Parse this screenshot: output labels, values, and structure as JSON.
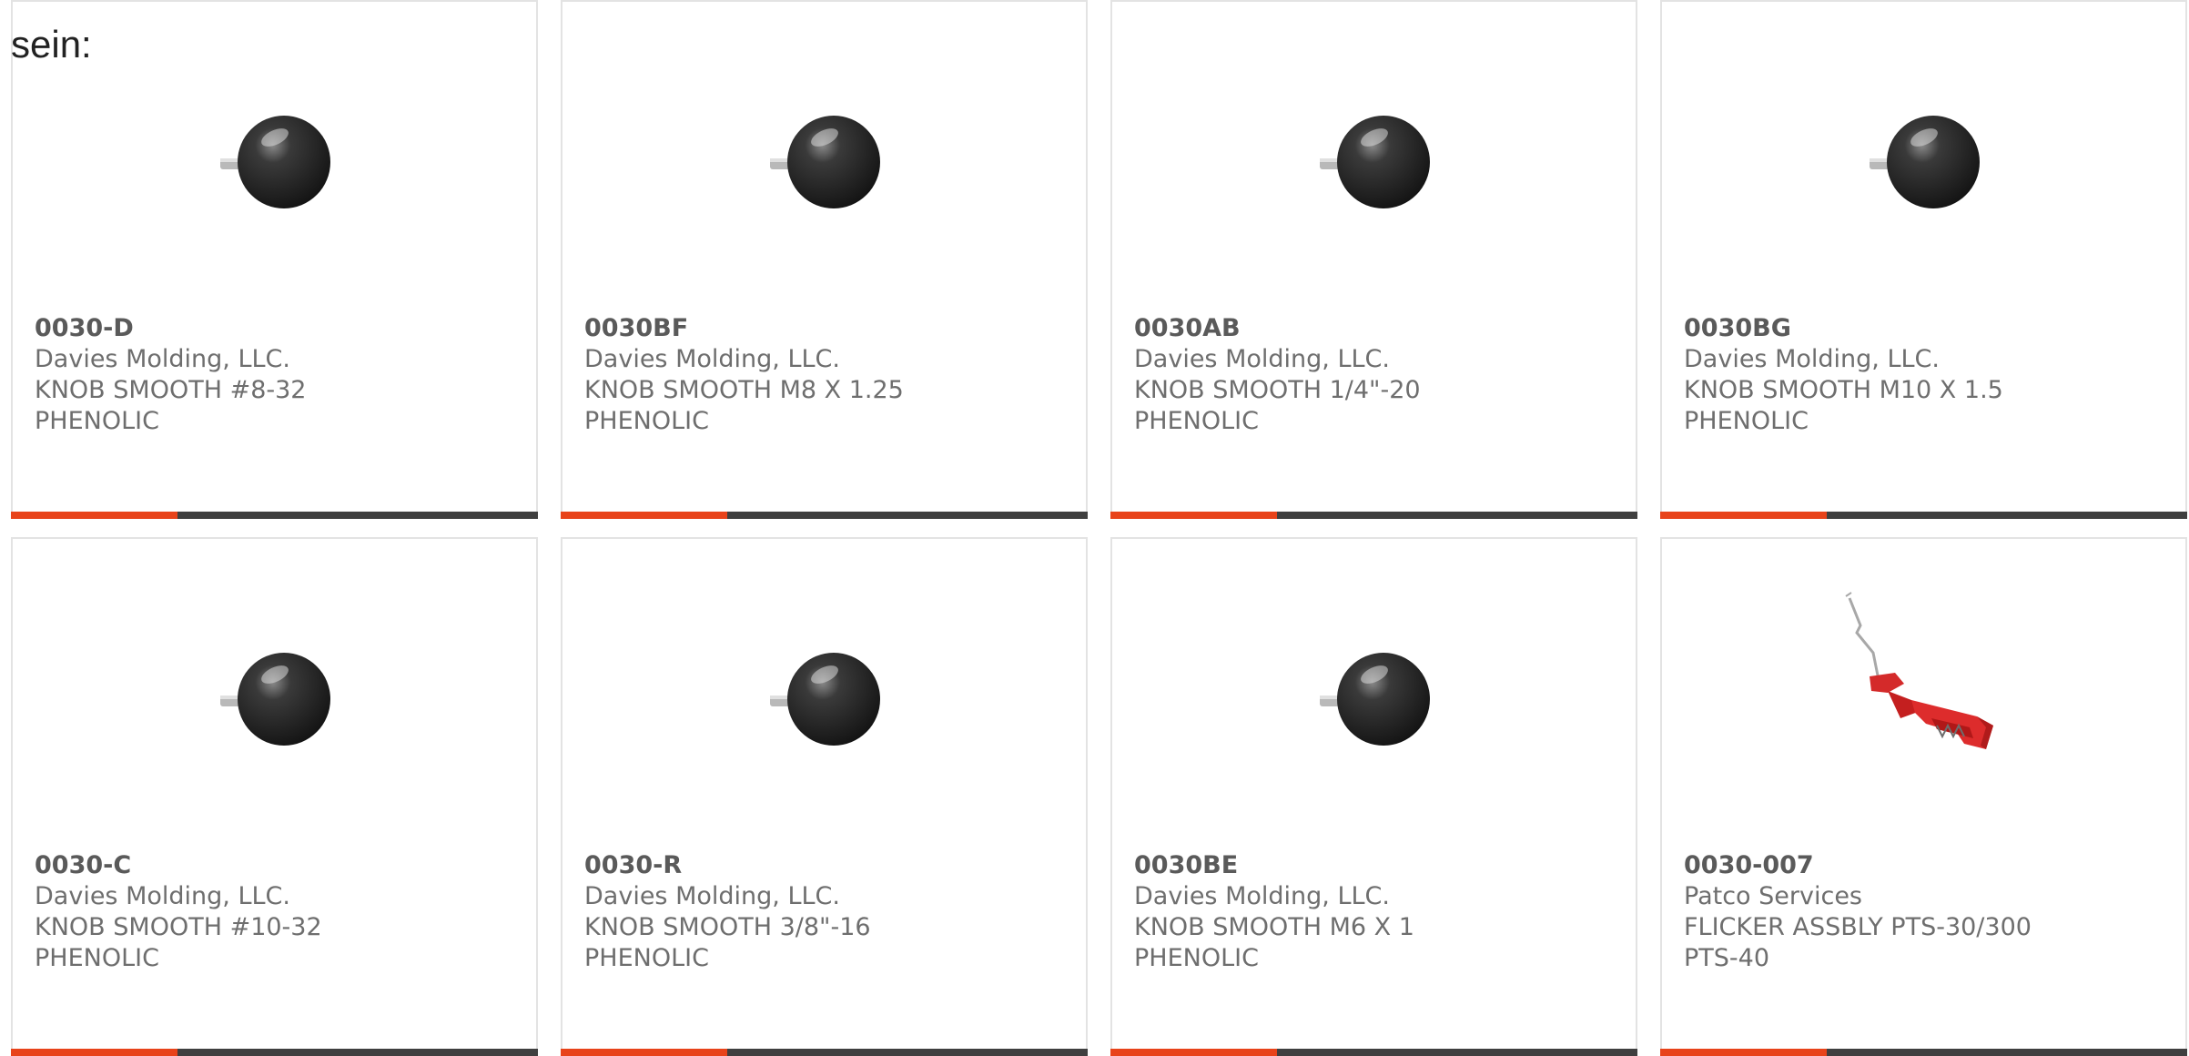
{
  "heading": "sein:",
  "colors": {
    "accent": "#e8431a",
    "bar": "#3f3f3f",
    "border": "#e3e3e3",
    "text": "#6e6e6e"
  },
  "products": [
    {
      "part": "0030-D",
      "manufacturer": "Davies Molding, LLC.",
      "desc1": "KNOB SMOOTH #8-32 PHENOLIC",
      "desc2": "",
      "image": "black-knob-icon"
    },
    {
      "part": "0030BF",
      "manufacturer": "Davies Molding, LLC.",
      "desc1": "KNOB SMOOTH M8 X 1.25",
      "desc2": "PHENOLIC",
      "image": "black-knob-icon"
    },
    {
      "part": "0030AB",
      "manufacturer": "Davies Molding, LLC.",
      "desc1": "KNOB SMOOTH 1/4\"-20",
      "desc2": "PHENOLIC",
      "image": "black-knob-icon"
    },
    {
      "part": "0030BG",
      "manufacturer": "Davies Molding, LLC.",
      "desc1": "KNOB SMOOTH M10 X 1.5",
      "desc2": "PHENOLIC",
      "image": "black-knob-icon"
    },
    {
      "part": "0030-C",
      "manufacturer": "Davies Molding, LLC.",
      "desc1": "KNOB SMOOTH #10-32",
      "desc2": "PHENOLIC",
      "image": "black-knob-icon"
    },
    {
      "part": "0030-R",
      "manufacturer": "Davies Molding, LLC.",
      "desc1": "KNOB SMOOTH 3/8\"-16",
      "desc2": "PHENOLIC",
      "image": "black-knob-icon"
    },
    {
      "part": "0030BE",
      "manufacturer": "Davies Molding, LLC.",
      "desc1": "KNOB SMOOTH M6 X 1",
      "desc2": "PHENOLIC",
      "image": "black-knob-icon"
    },
    {
      "part": "0030-007",
      "manufacturer": "Patco Services",
      "desc1": "FLICKER ASSBLY PTS-30/300",
      "desc2": "PTS-40",
      "image": "red-flicker-assembly-icon"
    }
  ]
}
